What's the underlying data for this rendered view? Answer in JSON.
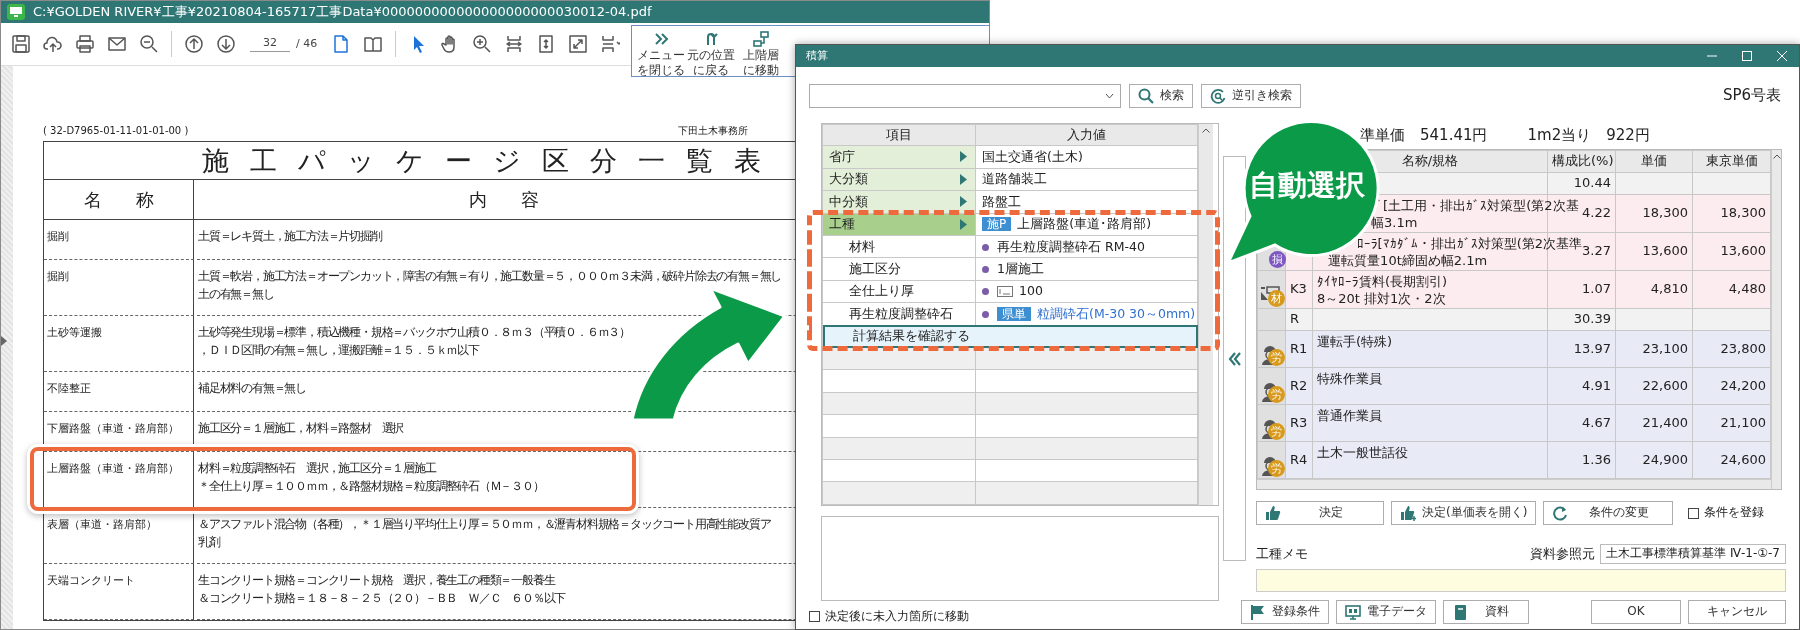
{
  "pdf_window": {
    "title": "C:¥GOLDEN RIVER¥工事¥20210804-165717工事Data¥000000000000000000000030012-04.pdf",
    "page_current": "32",
    "page_total": "/ 46",
    "menu": [
      {
        "kind": "close",
        "label": [
          "メニュー",
          "を閉じる"
        ]
      },
      {
        "kind": "back",
        "label": [
          "元の位置",
          "に戻る"
        ]
      },
      {
        "kind": "up",
        "label": [
          "上階層",
          "に移動"
        ]
      }
    ],
    "document": {
      "code": "( 32-D7965-01-11-01-01-00 )",
      "office": "下田土木事務所",
      "title": "施工パッケージ区分一覧表",
      "columns": [
        "名称",
        "内容"
      ],
      "rows": [
        {
          "name": "掘削",
          "content": [
            "土質＝レキ質土，施工方法＝片切掘削"
          ],
          "highlighted": false
        },
        {
          "name": "掘削",
          "content": [
            "土質＝軟岩，施工方法＝オープンカット，障害の有無＝有り，施工数量＝５，０００ｍ３未満，破砕片除去の有無＝無し",
            "土の有無＝無し"
          ],
          "highlighted": false
        },
        {
          "name": "土砂等運搬",
          "content": [
            "土砂等発生現場＝標準，積込機種・規格＝バックホウ山積０．８ｍ３（平積０．６ｍ３）",
            "，ＤＩＤ区間の有無＝無し，運搬距離＝１５．５ｋｍ以下"
          ],
          "highlighted": false
        },
        {
          "name": "不陸整正",
          "content": [
            "補足材料の有無＝無し"
          ],
          "highlighted": false
        },
        {
          "name": "下層路盤（車道・路肩部）",
          "content": [
            "施工区分＝１層施工，材料＝路盤材　選択"
          ],
          "highlighted": false
        },
        {
          "name": "上層路盤（車道・路肩部）",
          "content": [
            "材料＝粒度調整砕石　選択，施工区分＝１層施工",
            "＊全仕上り厚＝１００ｍｍ，＆路盤材規格＝粒度調整砕石（Ｍ－３０）"
          ],
          "highlighted": true
        },
        {
          "name": "表層（車道・路肩部）",
          "content": [
            "＆アスファルト混合物（各種），＊１層当り平均仕上り厚＝５０ｍｍ，＆瀝青材料規格＝タックコート用高性能改質ア",
            "乳剤"
          ],
          "highlighted": false
        },
        {
          "name": "天端コンクリート",
          "content": [
            "生コンクリート規格＝コンクリート規格　選択，養生工の種類＝一般養生",
            "＆コンクリート規格＝１８－８－２５（２０）－ＢＢ　Ｗ／Ｃ　６０％以下"
          ],
          "highlighted": false
        }
      ]
    }
  },
  "dialog": {
    "title": "積算",
    "search_button": "検索",
    "reverse_search_button": "逆引き検索",
    "table_code": "SP6号表",
    "input_grid": {
      "columns": [
        "項目",
        "入力値"
      ],
      "rows": [
        {
          "kind": "category",
          "label": "省庁",
          "value": "国土交通省(土木)",
          "auto_selected": false
        },
        {
          "kind": "category",
          "label": "大分類",
          "value": "道路舗装工",
          "auto_selected": false
        },
        {
          "kind": "category",
          "label": "中分類",
          "value": "路盤工",
          "auto_selected": false
        },
        {
          "kind": "work",
          "label": "工種",
          "tag": "施P",
          "value": "上層路盤(車道･路肩部)",
          "auto_selected": true
        },
        {
          "kind": "condition",
          "label": "材料",
          "value": "再生粒度調整砕石 RM-40",
          "auto_selected": true
        },
        {
          "kind": "condition",
          "label": "施工区分",
          "value": "1層施工",
          "auto_selected": true
        },
        {
          "kind": "numeric",
          "label": "全仕上り厚",
          "value": "100",
          "auto_selected": true
        },
        {
          "kind": "lookup",
          "label": "再生粒度調整砕石",
          "tag": "県単",
          "value": "粒調砕石(M-30 30～0mm)",
          "auto_selected": true
        },
        {
          "kind": "action",
          "label": "計算結果を確認する",
          "selected": true,
          "auto_selected": true
        }
      ]
    },
    "move_checkbox": {
      "label": "決定後に未入力箇所に移動",
      "checked": false
    },
    "unit_price": "準単価　541.41円",
    "per_m2": "1m2当り　922円",
    "cost_grid": {
      "columns": [
        "名称/規格",
        "構成比(%)",
        "単価",
        "東京単価"
      ],
      "rows": [
        {
          "kind": "subtotal",
          "ratio": "10.44"
        },
        {
          "kind": "machine",
          "name": [
            "ﾞ[土工用・排出ｶﾞｽ対策型(第2次基",
            "幅3.1m"
          ],
          "ratio": "4.22",
          "price": "18,300",
          "tokyo_price": "18,300"
        },
        {
          "kind": "machine",
          "badge": {
            "text": "損",
            "color": "#7e57c2"
          },
          "name": [
            "ﾛｰﾗ[ﾏｶﾀﾞﾑ・排出ｶﾞｽ対策型(第2次基準",
            "運転質量10t締固め幅2.1m"
          ],
          "ratio": "3.27",
          "price": "13,600",
          "tokyo_price": "13,600"
        },
        {
          "kind": "material",
          "badge": {
            "text": "材",
            "color": "#d89a1c"
          },
          "code": "K3",
          "name": [
            "ﾀｲﾔﾛｰﾗ賃料(長期割引)",
            "8～20t 排対1次・2次"
          ],
          "ratio": "1.07",
          "price": "4,810",
          "tokyo_price": "4,480"
        },
        {
          "kind": "subtotal",
          "code": "R",
          "ratio": "30.39"
        },
        {
          "kind": "labor",
          "badge": {
            "text": "労",
            "color": "#d89a1c"
          },
          "code": "R1",
          "name": [
            "運転手(特殊)"
          ],
          "ratio": "13.97",
          "price": "23,100",
          "tokyo_price": "23,800"
        },
        {
          "kind": "labor",
          "badge": {
            "text": "労",
            "color": "#d89a1c"
          },
          "code": "R2",
          "name": [
            "特殊作業員"
          ],
          "ratio": "4.91",
          "price": "22,600",
          "tokyo_price": "24,200"
        },
        {
          "kind": "labor",
          "badge": {
            "text": "労",
            "color": "#d89a1c"
          },
          "code": "R3",
          "name": [
            "普通作業員"
          ],
          "ratio": "4.67",
          "price": "21,400",
          "tokyo_price": "21,100"
        },
        {
          "kind": "labor",
          "badge": {
            "text": "労",
            "color": "#d89a1c"
          },
          "code": "R4",
          "name": [
            "土木一般世話役"
          ],
          "ratio": "1.36",
          "price": "24,900",
          "tokyo_price": "24,600"
        }
      ]
    },
    "action_buttons": [
      {
        "kind": "thumb",
        "label": "決定"
      },
      {
        "kind": "thumb-plus",
        "label": "決定(単価表を開く)"
      },
      {
        "kind": "refresh",
        "label": "条件の変更"
      }
    ],
    "register_checkbox": {
      "label": "条件を登録",
      "checked": false
    },
    "memo_label": "工種メモ",
    "reference_label": "資料参照元",
    "reference_value": "土木工事標準積算基準 Ⅳ-1-①-7",
    "bottom_buttons": [
      {
        "kind": "flag",
        "label": "登録条件"
      },
      {
        "kind": "monitor",
        "label": "電子データ"
      },
      {
        "kind": "book",
        "label": "資料"
      },
      {
        "kind": "ok",
        "label": "OK"
      },
      {
        "kind": "cancel",
        "label": "キャンセル"
      }
    ]
  },
  "callout": {
    "text": "自動選択"
  }
}
